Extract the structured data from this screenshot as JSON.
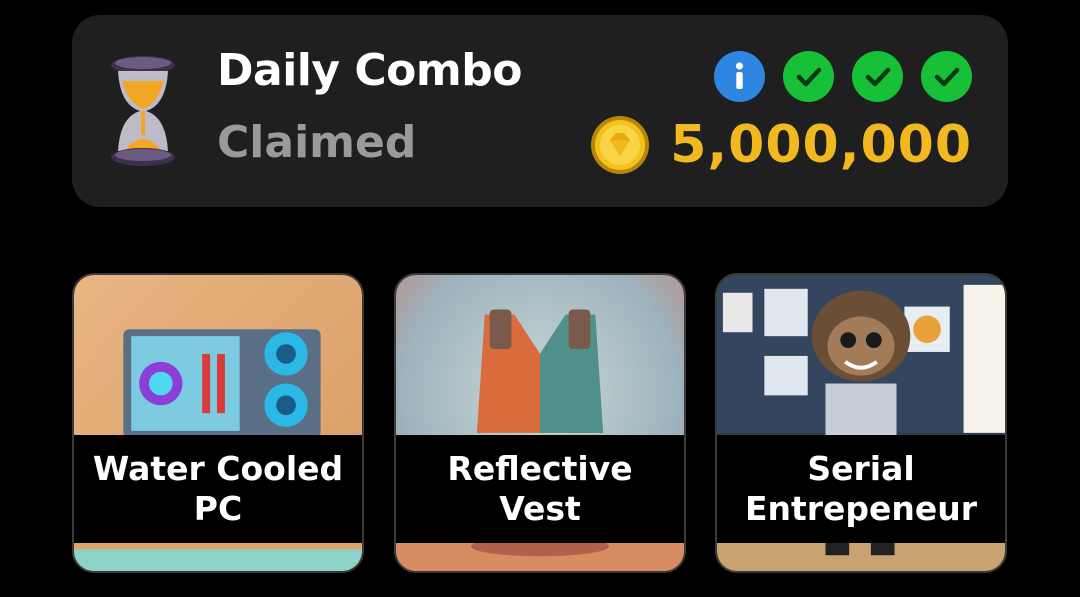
{
  "combo": {
    "title": "Daily Combo",
    "status": "Claimed",
    "reward_amount": "5,000,000",
    "hourglass_icon": "hourglass-icon",
    "info_icon": "info-icon",
    "coin_icon": "coin-icon",
    "check_icons": [
      "check-icon",
      "check-icon",
      "check-icon"
    ],
    "colors": {
      "accent_gold": "#f1b81f",
      "info_blue": "#2f86e0",
      "check_green": "#17c037",
      "card_bg": "#1f1f1f"
    }
  },
  "cards": [
    {
      "label": "Water Cooled\nPC",
      "image": "water-cooled-pc-image"
    },
    {
      "label": "Reflective\nVest",
      "image": "reflective-vest-image"
    },
    {
      "label": "Serial\nEntrepeneur",
      "image": "serial-entrepreneur-image"
    }
  ]
}
